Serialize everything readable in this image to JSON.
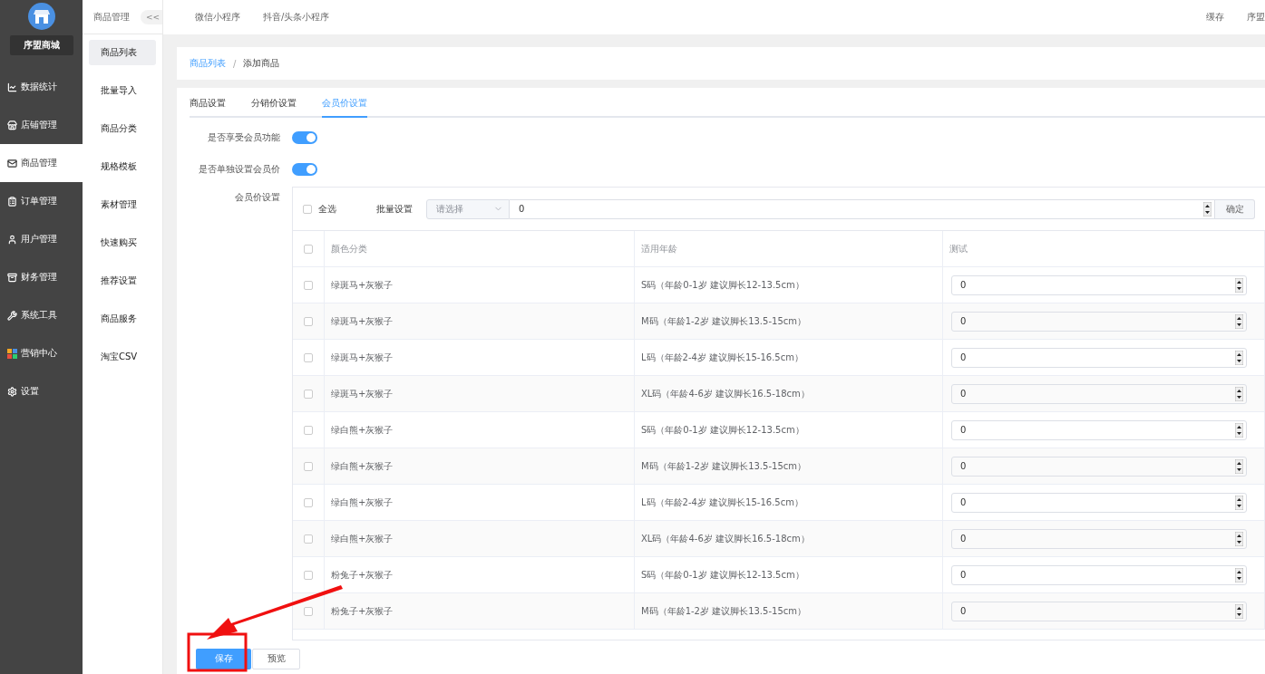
{
  "sidebar": {
    "brand": "序盟商城",
    "items": [
      {
        "label": "数据统计",
        "selected": false
      },
      {
        "label": "店铺管理",
        "selected": false
      },
      {
        "label": "商品管理",
        "selected": true
      },
      {
        "label": "订单管理",
        "selected": false
      },
      {
        "label": "用户管理",
        "selected": false
      },
      {
        "label": "财务管理",
        "selected": false
      },
      {
        "label": "系统工具",
        "selected": false
      },
      {
        "label": "营销中心",
        "selected": false
      },
      {
        "label": "设置",
        "selected": false
      }
    ]
  },
  "submenu": {
    "title": "商品管理",
    "collapse": "<<",
    "items": [
      {
        "label": "商品列表",
        "selected": true
      },
      {
        "label": "批量导入",
        "selected": false
      },
      {
        "label": "商品分类",
        "selected": false
      },
      {
        "label": "规格模板",
        "selected": false
      },
      {
        "label": "素材管理",
        "selected": false
      },
      {
        "label": "快速购买",
        "selected": false
      },
      {
        "label": "推荐设置",
        "selected": false
      },
      {
        "label": "商品服务",
        "selected": false
      },
      {
        "label": "淘宝CSV",
        "selected": false
      }
    ]
  },
  "topbar": {
    "tabs": [
      "微信小程序",
      "抖音/头条小程序"
    ],
    "actions": [
      "缓存",
      "序盟"
    ]
  },
  "breadcrumb": {
    "items": [
      "商品列表",
      "添加商品"
    ],
    "separator": "/"
  },
  "tabs": [
    {
      "label": "商品设置",
      "selected": false
    },
    {
      "label": "分销价设置",
      "selected": false
    },
    {
      "label": "会员价设置",
      "selected": true
    }
  ],
  "toggles": [
    {
      "label": "是否享受会员功能",
      "on": true
    },
    {
      "label": "是否单独设置会员价",
      "on": true
    }
  ],
  "member_price": {
    "label": "会员价设置",
    "select_all": {
      "label": "全选",
      "checked": false
    },
    "batch_label": "批量设置",
    "batch_select": {
      "placeholder": "请选择"
    },
    "batch_value": "0",
    "confirm": "确定",
    "columns": [
      "颜色分类",
      "适用年龄",
      "测试"
    ],
    "header_checked": false,
    "rows": [
      {
        "color_category": "绿斑马+灰猴子",
        "age": "S码（年龄0-1岁 建议脚长12-13.5cm）",
        "value": "0",
        "checked": false
      },
      {
        "color_category": "绿斑马+灰猴子",
        "age": "M码（年龄1-2岁 建议脚长13.5-15cm）",
        "value": "0",
        "checked": false
      },
      {
        "color_category": "绿斑马+灰猴子",
        "age": "L码（年龄2-4岁 建议脚长15-16.5cm）",
        "value": "0",
        "checked": false
      },
      {
        "color_category": "绿斑马+灰猴子",
        "age": "XL码（年龄4-6岁 建议脚长16.5-18cm）",
        "value": "0",
        "checked": false
      },
      {
        "color_category": "绿白熊+灰猴子",
        "age": "S码（年龄0-1岁 建议脚长12-13.5cm）",
        "value": "0",
        "checked": false
      },
      {
        "color_category": "绿白熊+灰猴子",
        "age": "M码（年龄1-2岁 建议脚长13.5-15cm）",
        "value": "0",
        "checked": false
      },
      {
        "color_category": "绿白熊+灰猴子",
        "age": "L码（年龄2-4岁 建议脚长15-16.5cm）",
        "value": "0",
        "checked": false
      },
      {
        "color_category": "绿白熊+灰猴子",
        "age": "XL码（年龄4-6岁 建议脚长16.5-18cm）",
        "value": "0",
        "checked": false
      },
      {
        "color_category": "粉兔子+灰猴子",
        "age": "S码（年龄0-1岁 建议脚长12-13.5cm）",
        "value": "0",
        "checked": false
      },
      {
        "color_category": "粉兔子+灰猴子",
        "age": "M码（年龄1-2岁 建议脚长13.5-15cm）",
        "value": "0",
        "checked": false
      }
    ]
  },
  "footer": {
    "save": "保存",
    "preview": "预览"
  }
}
